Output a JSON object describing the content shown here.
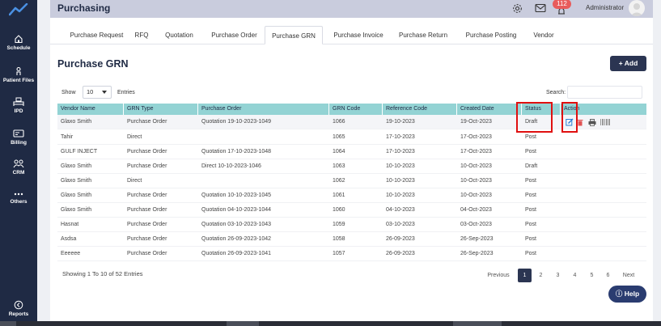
{
  "sidebar": {
    "items": [
      {
        "label": "Schedule",
        "icon": "home-icon"
      },
      {
        "label": "Patient Files",
        "icon": "user-file-icon"
      },
      {
        "label": "IPD",
        "icon": "bed-icon"
      },
      {
        "label": "Billing",
        "icon": "billing-icon"
      },
      {
        "label": "CRM",
        "icon": "crm-icon"
      },
      {
        "label": "Others",
        "icon": "dots-icon"
      },
      {
        "label": "Reports",
        "icon": "reports-icon"
      }
    ]
  },
  "header": {
    "title": "Purchasing",
    "notification_count": "112",
    "user_name": "Administrator"
  },
  "tabs": [
    "Purchase Request",
    "RFQ",
    "Quotation",
    "Purchase Order",
    "Purchase GRN",
    "Purchase Invoice",
    "Purchase Return",
    "Purchase Posting",
    "Vendor"
  ],
  "active_tab": "Purchase GRN",
  "section": {
    "title": "Purchase GRN",
    "add_label": "Add"
  },
  "controls": {
    "show_label": "Show",
    "show_value": "10",
    "entries_label": "Entries",
    "search_label": "Search:"
  },
  "table": {
    "columns": [
      "Vendor Name",
      "GRN Type",
      "Purchase Order",
      "GRN Code",
      "Reference Code",
      "Created Date",
      "Status",
      "Action"
    ],
    "rows": [
      [
        "Glaxo Smith",
        "Purchase Order",
        "Quotation 19-10-2023-1049",
        "1066",
        "19-10-2023",
        "19-Oct-2023",
        "Draft"
      ],
      [
        "Tahir",
        "Direct",
        "",
        "1065",
        "17-10-2023",
        "17-Oct-2023",
        "Post"
      ],
      [
        "GULF INJECT",
        "Purchase Order",
        "Quotation 17-10-2023-1048",
        "1064",
        "17-10-2023",
        "17-Oct-2023",
        "Post"
      ],
      [
        "Glaxo Smith",
        "Purchase Order",
        "Direct 10-10-2023-1046",
        "1063",
        "10-10-2023",
        "10-Oct-2023",
        "Draft"
      ],
      [
        "Glaxo Smith",
        "Direct",
        "",
        "1062",
        "10-10-2023",
        "10-Oct-2023",
        "Post"
      ],
      [
        "Glaxo Smith",
        "Purchase Order",
        "Quotation 10-10-2023-1045",
        "1061",
        "10-10-2023",
        "10-Oct-2023",
        "Post"
      ],
      [
        "Glaxo Smith",
        "Purchase Order",
        "Quotation 04-10-2023-1044",
        "1060",
        "04-10-2023",
        "04-Oct-2023",
        "Post"
      ],
      [
        "Hasnat",
        "Purchase Order",
        "Quotation 03-10-2023-1043",
        "1059",
        "03-10-2023",
        "03-Oct-2023",
        "Post"
      ],
      [
        "Asdsa",
        "Purchase Order",
        "Quotation 26-09-2023-1042",
        "1058",
        "26-09-2023",
        "26-Sep-2023",
        "Post"
      ],
      [
        "Eeeeee",
        "Purchase Order",
        "Quotation 26-09-2023-1041",
        "1057",
        "26-09-2023",
        "26-Sep-2023",
        "Post"
      ]
    ]
  },
  "footer": {
    "showing_text": "Showing 1 To 10 of 52 Entries",
    "previous": "Previous",
    "pages": [
      "1",
      "2",
      "3",
      "4",
      "5",
      "6"
    ],
    "next": "Next",
    "help_label": "Help"
  },
  "colors": {
    "sidebar": "#1f2a44",
    "table_header": "#93d3d4",
    "button": "#2b3552",
    "badge": "#e85b5b",
    "highlight": "#e01010",
    "edit_icon": "#2a7fd4",
    "delete_icon": "#e05353"
  }
}
